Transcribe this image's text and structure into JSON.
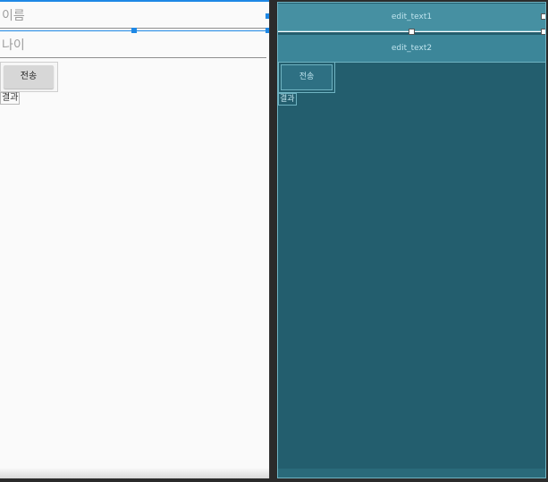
{
  "design": {
    "edit_text1_hint": "이름",
    "edit_text2_hint": "나이",
    "send_button_label": "전송",
    "result_label": "결과"
  },
  "blueprint": {
    "edit_text1_id": "edit_text1",
    "edit_text2_id": "edit_text2",
    "send_button_label": "전송",
    "result_label": "결과"
  },
  "colors": {
    "selection": "#1e88e5",
    "blueprint_bg": "#235e6e",
    "blueprint_line": "#6fb3c2"
  }
}
